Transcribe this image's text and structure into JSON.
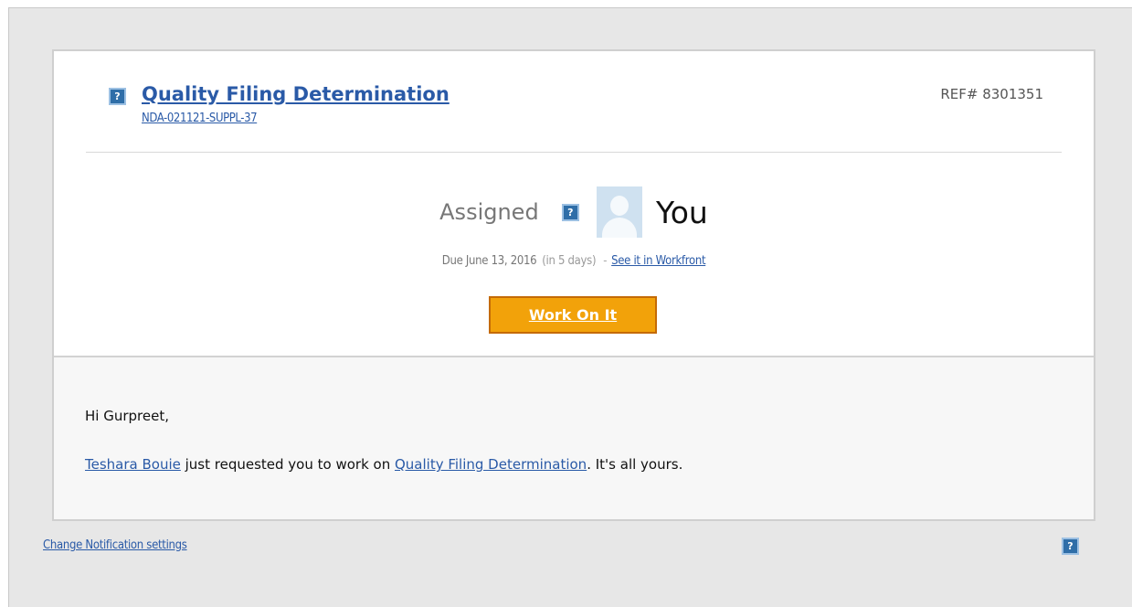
{
  "header": {
    "title": "Quality Filing Determination",
    "subtitle": "NDA-021121-SUPPL-37",
    "ref": "REF# 8301351",
    "help_icon": "question-icon"
  },
  "assignment": {
    "assigned_label": "Assigned",
    "assignee": "You",
    "avatar_icon": "default-user-avatar",
    "due_text": "Due June 13, 2016",
    "days_text": "(in 5 days)",
    "separator": "-",
    "workfront_link": "See it in Workfront",
    "work_button": "Work On It"
  },
  "message": {
    "greeting": "Hi Gurpreet,",
    "requester": "Teshara Bouie",
    "middle_text": " just requested you to work on ",
    "task_link": "Quality Filing Determination",
    "end_text": ". It's all yours."
  },
  "footer": {
    "settings_link": "Change Notification settings",
    "help_icon": "question-icon"
  },
  "colors": {
    "link": "#2a5aa7",
    "button_bg": "#f2a20a",
    "button_border": "#c46a06",
    "help_icon_bg": "#2f6ea8",
    "outer_bg": "#e7e7e7"
  }
}
